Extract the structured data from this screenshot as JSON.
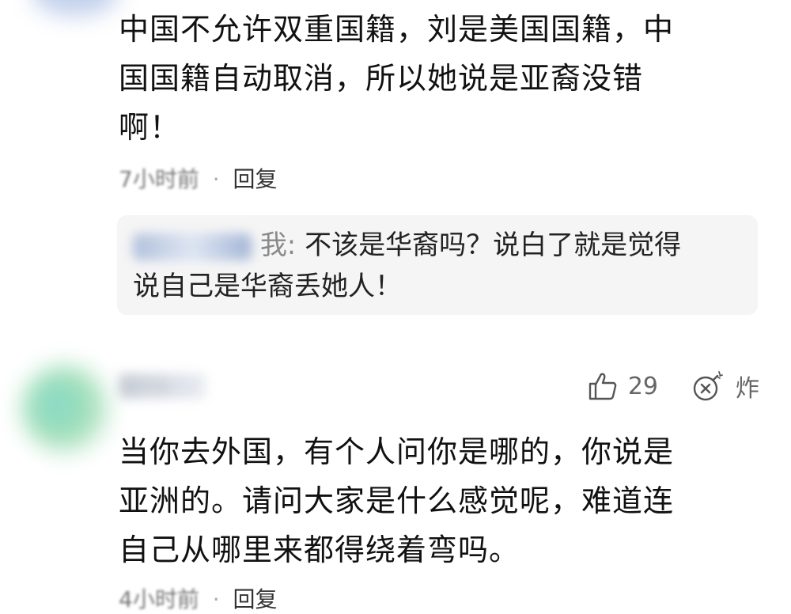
{
  "comment1": {
    "text_lines": [
      "中国不允许双重国籍，刘是美国国籍，中",
      "国国籍自动取消，所以她说是亚裔没错",
      "啊！"
    ],
    "time": "7小时前",
    "reply_label": "回复"
  },
  "reply1": {
    "author_suffix": "我:",
    "text_lines": [
      "不该是华裔吗？说白了就是觉得",
      "说自己是华裔丢她人！"
    ]
  },
  "comment2": {
    "username_blurred": "用户名",
    "likes": "29",
    "bomb_label": "炸",
    "text_lines": [
      "当你去外国，有个人问你是哪的，你说是",
      "亚洲的。请问大家是什么感觉呢，难道连",
      "自己从哪里来都得绕着弯吗。"
    ],
    "time": "4小时前",
    "reply_label": "回复"
  },
  "icons": {
    "like": "thumbs-up-icon",
    "bomb": "bomb-icon"
  }
}
